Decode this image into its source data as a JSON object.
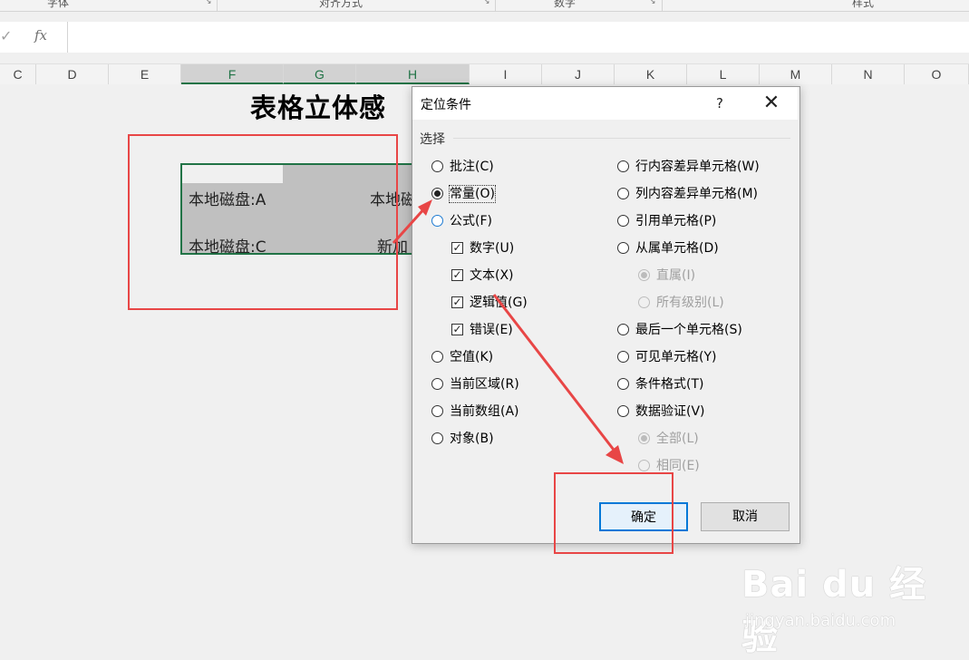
{
  "ribbon": {
    "groups": [
      {
        "label": "字体"
      },
      {
        "label": "对齐方式"
      },
      {
        "label": "数字"
      },
      {
        "label": "样式"
      }
    ],
    "launcher_icon": "dialog-launcher-icon"
  },
  "formula_bar": {
    "check_icon": "✓",
    "fx_label": "fx",
    "value": ""
  },
  "columns": [
    "C",
    "D",
    "E",
    "F",
    "G",
    "H",
    "I",
    "J",
    "K",
    "L",
    "M",
    "N",
    "O"
  ],
  "sheet": {
    "title": "表格立体感",
    "cells": [
      "本地磁盘:A",
      "本地磁",
      "本地磁盘:C",
      "新加"
    ]
  },
  "dialog": {
    "title": "定位条件",
    "help": "?",
    "close": "✕",
    "section": "选择",
    "left_options": [
      {
        "label": "批注(C)",
        "selected": false
      },
      {
        "label": "常量(O)",
        "selected": true
      },
      {
        "label": "公式(F)",
        "selected": false
      },
      {
        "label": "数字(U)",
        "checked": true
      },
      {
        "label": "文本(X)",
        "checked": true
      },
      {
        "label": "逻辑值(G)",
        "checked": true
      },
      {
        "label": "错误(E)",
        "checked": true
      },
      {
        "label": "空值(K)",
        "selected": false
      },
      {
        "label": "当前区域(R)",
        "selected": false
      },
      {
        "label": "当前数组(A)",
        "selected": false
      },
      {
        "label": "对象(B)",
        "selected": false
      }
    ],
    "right_options": [
      {
        "label": "行内容差异单元格(W)",
        "selected": false
      },
      {
        "label": "列内容差异单元格(M)",
        "selected": false
      },
      {
        "label": "引用单元格(P)",
        "selected": false
      },
      {
        "label": "从属单元格(D)",
        "selected": false
      },
      {
        "label": "直属(I)",
        "selected": true,
        "disabled": true
      },
      {
        "label": "所有级别(L)",
        "selected": false,
        "disabled": true
      },
      {
        "label": "最后一个单元格(S)",
        "selected": false
      },
      {
        "label": "可见单元格(Y)",
        "selected": false
      },
      {
        "label": "条件格式(T)",
        "selected": false
      },
      {
        "label": "数据验证(V)",
        "selected": false
      },
      {
        "label": "全部(L)",
        "selected": true,
        "disabled": true
      },
      {
        "label": "相同(E)",
        "selected": false,
        "disabled": true
      }
    ],
    "ok": "确定",
    "cancel": "取消"
  },
  "annotation_color": "#e84646",
  "watermark": {
    "logo": "Bai du 经验",
    "url": "jingyan.baidu.com"
  }
}
